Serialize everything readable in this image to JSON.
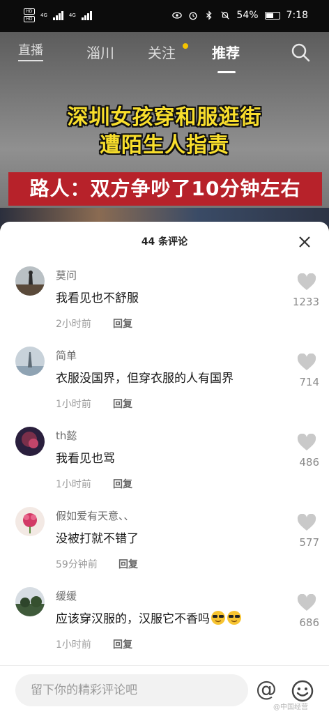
{
  "status_bar": {
    "network_left": "HD",
    "network_right": "HD",
    "signal1": "4G",
    "signal2": "4G",
    "battery": "54%",
    "time": "7:18"
  },
  "nav": {
    "live": "直播",
    "local": "淄川",
    "follow": "关注",
    "recommend": "推荐"
  },
  "video": {
    "headline1": "深圳女孩穿和服逛街",
    "headline2": "遭陌生人指责",
    "headline3": "路人：双方争吵了10分钟左右"
  },
  "comments_sheet": {
    "title": "44 条评论",
    "reply_label": "回复",
    "comments": [
      {
        "user": "莫问",
        "text": "我看见也不舒服",
        "time": "2小时前",
        "likes": "1233"
      },
      {
        "user": "简单",
        "text": "衣服没国界，但穿衣服的人有国界",
        "time": "1小时前",
        "likes": "714"
      },
      {
        "user": "th懿",
        "text": "我看见也骂",
        "time": "1小时前",
        "likes": "486"
      },
      {
        "user": "假如爱有天意、、",
        "text": "没被打就不错了",
        "time": "59分钟前",
        "likes": "577"
      },
      {
        "user": "缓缓",
        "text": "应该穿汉服的，汉服它不香吗",
        "time": "1小时前",
        "likes": "686"
      }
    ]
  },
  "input_bar": {
    "placeholder": "留下你的精彩评论吧",
    "at_symbol": "@"
  },
  "watermark": "@中国经营",
  "colors": {
    "headline_yellow": "#f8de2c",
    "headline_red": "#b7222a",
    "notify_dot": "#f5c400"
  }
}
